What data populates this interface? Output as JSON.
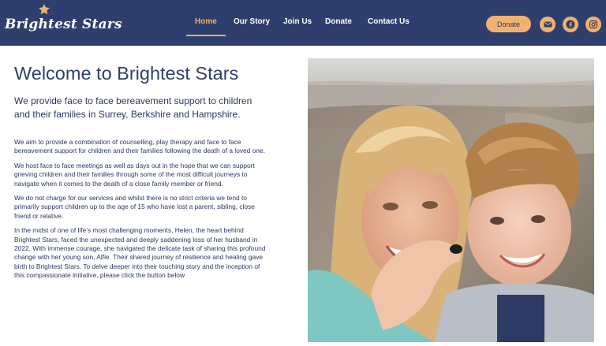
{
  "brand": {
    "name": "Brightest Stars",
    "colors": {
      "navy": "#2f3f6d",
      "accent": "#f1b16f",
      "text": "#2b3760"
    }
  },
  "nav": {
    "items": [
      {
        "label": "Home",
        "active": true
      },
      {
        "label": "Our Story",
        "active": false
      },
      {
        "label": "Join Us",
        "active": false
      },
      {
        "label": "Donate",
        "active": false
      },
      {
        "label": "Contact Us",
        "active": false
      }
    ],
    "donate_button": "Donate",
    "social_icons": [
      "email-icon",
      "facebook-icon",
      "instagram-icon"
    ]
  },
  "main": {
    "title": "Welcome to Brightest Stars",
    "lead": "We provide face to face bereavement support to children and their families in Surrey, Berkshire and Hampshire.",
    "paragraphs": [
      "We aim to provide a combination of counselling, play therapy and face to face bereavement support for children and their families following the death of a loved one.",
      "We host face to face meetings as well as days out in the hope that we can support grieving children and their families through some of the most difficult journeys to navigate when it comes to the death of a close family member or friend.",
      "We do not charge for our services and whilst there is no strict criteria we tend to primarily support children up to the age of 15 who have lost a parent, sibling, close friend or relative.",
      "In the midst of one of life’s most challenging moments, Helen, the heart behind Brightest Stars, faced the unexpected and deeply saddening loss of her husband in 2022. With immense courage, she navigated the delicate task of sharing this profound change with her young son, Alfie. Their shared journey of resilience and healing gave birth to Brightest Stars. To delve deeper into their touching story and the inception of this compassionate initiative, please click the button below"
    ]
  }
}
